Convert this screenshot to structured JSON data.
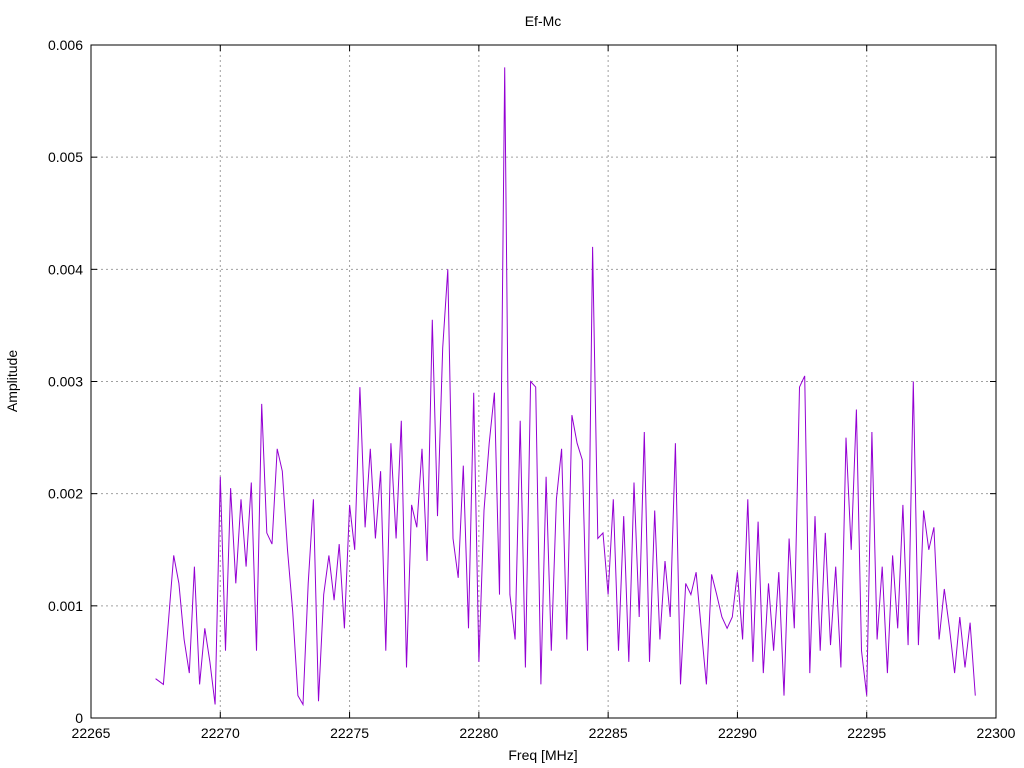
{
  "chart_data": {
    "type": "line",
    "title": "Ef-Mc",
    "xlabel": "Freq [MHz]",
    "ylabel": "Amplitude",
    "xlim": [
      22265,
      22300
    ],
    "ylim": [
      0,
      0.006
    ],
    "x_ticks": [
      22265,
      22270,
      22275,
      22280,
      22285,
      22290,
      22295,
      22300
    ],
    "x_tick_labels": [
      "22265",
      "22270",
      "22275",
      "22280",
      "22285",
      "22290",
      "22295",
      "22300"
    ],
    "y_ticks": [
      0,
      0.001,
      0.002,
      0.003,
      0.004,
      0.005,
      0.006
    ],
    "y_tick_labels": [
      "0",
      "0.001",
      "0.002",
      "0.003",
      "0.004",
      "0.005",
      "0.006"
    ],
    "grid": true,
    "series_color": "#9400d3",
    "x": [
      22267.5,
      22267.8,
      22268.0,
      22268.2,
      22268.4,
      22268.6,
      22268.8,
      22269.0,
      22269.2,
      22269.4,
      22269.6,
      22269.8,
      22270.0,
      22270.2,
      22270.4,
      22270.6,
      22270.8,
      22271.0,
      22271.2,
      22271.4,
      22271.6,
      22271.8,
      22272.0,
      22272.2,
      22272.4,
      22272.6,
      22272.8,
      22273.0,
      22273.2,
      22273.4,
      22273.6,
      22273.8,
      22274.0,
      22274.2,
      22274.4,
      22274.6,
      22274.8,
      22275.0,
      22275.2,
      22275.4,
      22275.6,
      22275.8,
      22276.0,
      22276.2,
      22276.4,
      22276.6,
      22276.8,
      22277.0,
      22277.2,
      22277.4,
      22277.6,
      22277.8,
      22278.0,
      22278.2,
      22278.4,
      22278.6,
      22278.8,
      22279.0,
      22279.2,
      22279.4,
      22279.6,
      22279.8,
      22280.0,
      22280.2,
      22280.4,
      22280.6,
      22280.8,
      22281.0,
      22281.2,
      22281.4,
      22281.6,
      22281.8,
      22282.0,
      22282.2,
      22282.4,
      22282.6,
      22282.8,
      22283.0,
      22283.2,
      22283.4,
      22283.6,
      22283.8,
      22284.0,
      22284.2,
      22284.4,
      22284.6,
      22284.8,
      22285.0,
      22285.2,
      22285.4,
      22285.6,
      22285.8,
      22286.0,
      22286.2,
      22286.4,
      22286.6,
      22286.8,
      22287.0,
      22287.2,
      22287.4,
      22287.6,
      22287.8,
      22288.0,
      22288.2,
      22288.4,
      22288.6,
      22288.8,
      22289.0,
      22289.2,
      22289.4,
      22289.6,
      22289.8,
      22290.0,
      22290.2,
      22290.4,
      22290.6,
      22290.8,
      22291.0,
      22291.2,
      22291.4,
      22291.6,
      22291.8,
      22292.0,
      22292.2,
      22292.4,
      22292.6,
      22292.8,
      22293.0,
      22293.2,
      22293.4,
      22293.6,
      22293.8,
      22294.0,
      22294.2,
      22294.4,
      22294.6,
      22294.8,
      22295.0,
      22295.2,
      22295.4,
      22295.6,
      22295.8,
      22296.0,
      22296.2,
      22296.4,
      22296.6,
      22296.8,
      22297.0,
      22297.2,
      22297.4,
      22297.6,
      22297.8,
      22298.0,
      22298.2,
      22298.4,
      22298.6,
      22298.8,
      22299.0,
      22299.2,
      22299.4
    ],
    "y": [
      0.00035,
      0.0003,
      0.00088,
      0.00145,
      0.0012,
      0.0007,
      0.0004,
      0.00135,
      0.0003,
      0.0008,
      0.0005,
      0.00012,
      0.00215,
      0.0006,
      0.00205,
      0.0012,
      0.00195,
      0.00135,
      0.0021,
      0.0006,
      0.0028,
      0.00165,
      0.00155,
      0.0024,
      0.0022,
      0.0015,
      0.00095,
      0.0002,
      0.00012,
      0.0012,
      0.00195,
      0.00015,
      0.0011,
      0.00145,
      0.00105,
      0.00155,
      0.0008,
      0.0019,
      0.0015,
      0.00295,
      0.0017,
      0.0024,
      0.0016,
      0.0022,
      0.0006,
      0.00245,
      0.0016,
      0.00265,
      0.00045,
      0.0019,
      0.0017,
      0.0024,
      0.0014,
      0.00355,
      0.0018,
      0.0033,
      0.004,
      0.0016,
      0.00125,
      0.00225,
      0.0008,
      0.0029,
      0.0005,
      0.00185,
      0.00245,
      0.0029,
      0.0011,
      0.0058,
      0.0011,
      0.0007,
      0.00265,
      0.00045,
      0.003,
      0.00295,
      0.0003,
      0.00215,
      0.0006,
      0.00195,
      0.0024,
      0.0007,
      0.0027,
      0.00245,
      0.0023,
      0.0006,
      0.0042,
      0.0016,
      0.00165,
      0.0011,
      0.00195,
      0.0006,
      0.0018,
      0.0005,
      0.0021,
      0.0009,
      0.00255,
      0.0005,
      0.00185,
      0.0007,
      0.0014,
      0.0009,
      0.00245,
      0.0003,
      0.0012,
      0.0011,
      0.0013,
      0.0008,
      0.0003,
      0.00128,
      0.0011,
      0.0009,
      0.0008,
      0.0009,
      0.0013,
      0.0007,
      0.00195,
      0.0005,
      0.00175,
      0.0004,
      0.0012,
      0.0006,
      0.0013,
      0.0002,
      0.0016,
      0.0008,
      0.00295,
      0.00305,
      0.0004,
      0.0018,
      0.0006,
      0.00165,
      0.00065,
      0.00135,
      0.00045,
      0.0025,
      0.0015,
      0.00275,
      0.0006,
      0.0002,
      0.00255,
      0.0007,
      0.00135,
      0.0004,
      0.00145,
      0.0008,
      0.0019,
      0.00065,
      0.003,
      0.00065,
      0.00185,
      0.0015,
      0.0017,
      0.0007,
      0.00115,
      0.0008,
      0.0004,
      0.0009,
      0.00045,
      0.00085,
      0.0002
    ]
  }
}
